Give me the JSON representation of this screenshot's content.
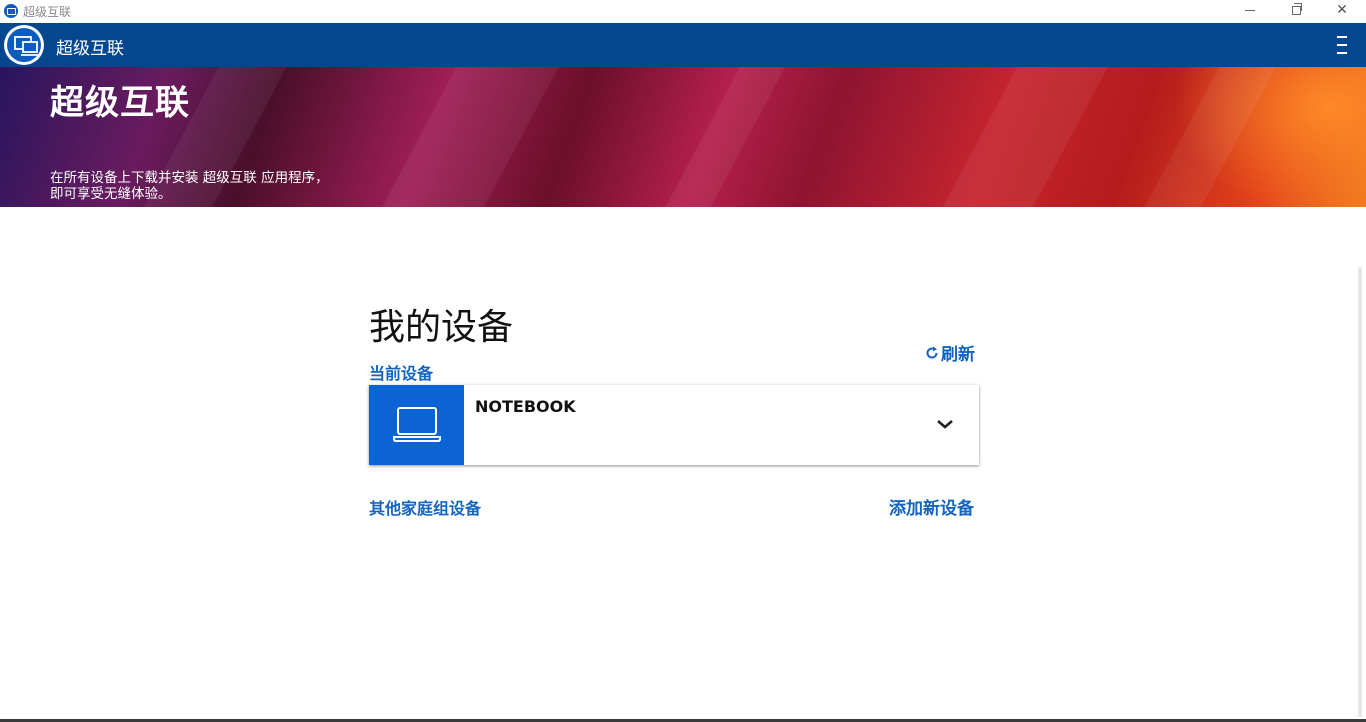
{
  "window": {
    "title": "超级互联",
    "controls": [
      "minimize-icon",
      "restore-icon",
      "close-icon"
    ]
  },
  "appbar": {
    "name": "超级互联",
    "menu_icon": "hamburger-menu-icon"
  },
  "banner": {
    "title": "超级互联",
    "subtitle": "在所有设备上下载并安装 超级互联 应用程序，即可享受无缝体验。"
  },
  "main": {
    "title": "我的设备",
    "refresh_label": "刷新",
    "current_device_label": "当前设备",
    "current_device": {
      "name": "NOTEBOOK",
      "icon": "laptop-icon"
    },
    "other_devices_label": "其他家庭组设备",
    "add_device_label": "添加新设备"
  },
  "colors": {
    "appbar": "#04478f",
    "accent": "#1565c0",
    "device_icon_bg": "#0c63d6"
  }
}
